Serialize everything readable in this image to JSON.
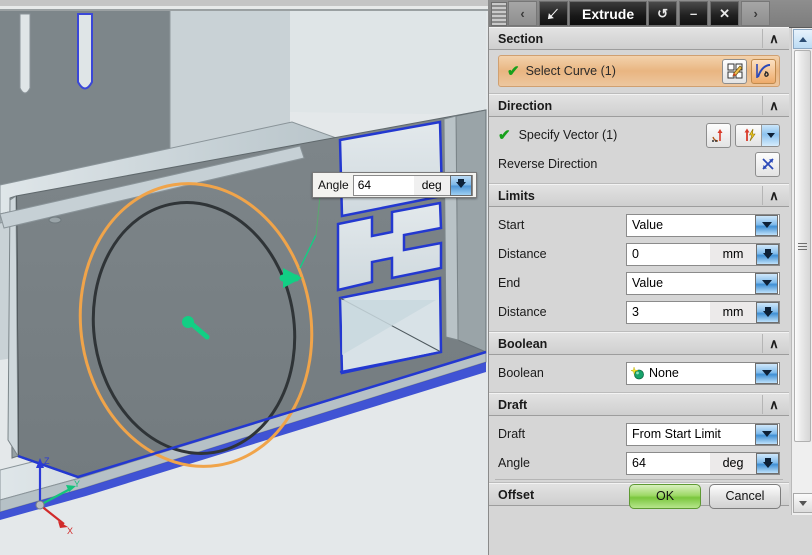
{
  "titlebar": {
    "back_icon": "chevron-left-icon",
    "pointer_icon": "arrow-pointer-icon",
    "title": "Extrude",
    "reset_icon": "reset-icon",
    "minimize_label": "–",
    "close_label": "✕",
    "forward_icon": "chevron-right-icon",
    "back_label": "‹",
    "forward_label": "›",
    "reset_label": "↺"
  },
  "canvas_angle": {
    "label": "Angle",
    "value": "64",
    "unit": "deg",
    "spinner_icon": "spinner-down-icon"
  },
  "sections": {
    "section": {
      "header": "Section",
      "collapse_icon": "chevron-up-icon",
      "select_curve": {
        "label": "Select Curve (1)",
        "check_icon": "green-check-icon",
        "sketch_icon": "sketch-section-icon",
        "curve_icon": "select-curve-icon"
      }
    },
    "direction": {
      "header": "Direction",
      "collapse_icon": "chevron-up-icon",
      "specify_vector": {
        "label": "Specify Vector (1)",
        "check_icon": "green-check-icon",
        "vector_dialog_icon": "vector-dialog-icon",
        "inferred_vector_icon": "inferred-vector-icon",
        "dropdown_icon": "chevron-down-icon"
      },
      "reverse_direction": {
        "label": "Reverse Direction",
        "icon": "reverse-direction-icon"
      }
    },
    "limits": {
      "header": "Limits",
      "collapse_icon": "chevron-up-icon",
      "rows": [
        {
          "label": "Start",
          "type": "combo",
          "value": "Value"
        },
        {
          "label": "Distance",
          "type": "number",
          "value": "0",
          "unit": "mm"
        },
        {
          "label": "End",
          "type": "combo",
          "value": "Value"
        },
        {
          "label": "Distance",
          "type": "number",
          "value": "3",
          "unit": "mm"
        }
      ]
    },
    "boolean": {
      "header": "Boolean",
      "collapse_icon": "chevron-up-icon",
      "row": {
        "label": "Boolean",
        "value": "None",
        "option_icon": "boolean-none-icon"
      }
    },
    "draft": {
      "header": "Draft",
      "collapse_icon": "chevron-up-icon",
      "rows": [
        {
          "label": "Draft",
          "type": "combo",
          "value": "From Start Limit"
        },
        {
          "label": "Angle",
          "type": "number",
          "value": "64",
          "unit": "deg"
        }
      ]
    },
    "offset": {
      "header": "Offset",
      "expand_icon": "chevron-down-icon",
      "expand_label": "∨"
    }
  },
  "buttons": {
    "ok": "OK",
    "cancel": "Cancel"
  },
  "scrollbar": {
    "up_icon": "scroll-up-icon",
    "down_icon": "scroll-down-icon",
    "thumb_icon": "scroll-thumb-grip"
  },
  "viewport": {
    "triad": {
      "z_label": "Z",
      "y_label": "Y",
      "x_label": "X"
    },
    "colors": {
      "background": "#e4e8ea",
      "part_face": "#7a8285",
      "flange": "#c8d2d6",
      "selected_curve": "#f0a44a",
      "edge_highlight": "#2338d0",
      "handle": "#10c97e"
    }
  },
  "chevrons": {
    "up": "∧",
    "down": "∨"
  }
}
